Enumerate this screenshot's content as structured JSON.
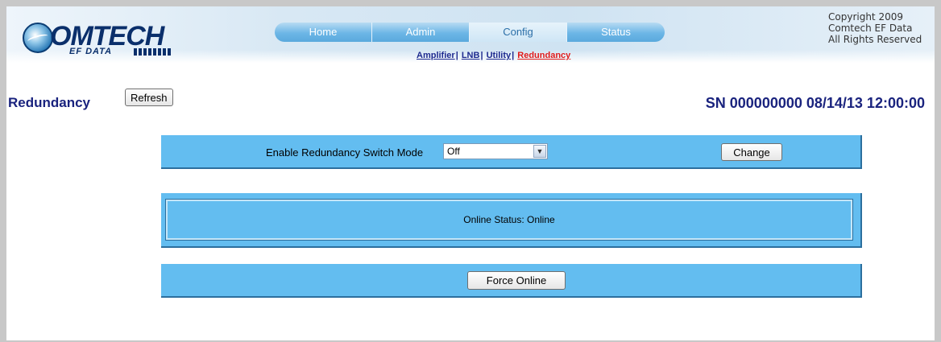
{
  "header": {
    "logo": {
      "word": "OMTECH",
      "sub": "EF DATA"
    },
    "copyright": [
      "Copyright 2009",
      "Comtech EF Data",
      "All Rights Reserved"
    ],
    "tabs": [
      {
        "label": "Home",
        "active": false
      },
      {
        "label": "Admin",
        "active": false
      },
      {
        "label": "Config",
        "active": true
      },
      {
        "label": "Status",
        "active": false
      }
    ],
    "subnav": [
      {
        "label": "Amplifier",
        "active": false
      },
      {
        "label": "LNB",
        "active": false
      },
      {
        "label": "Utility",
        "active": false
      },
      {
        "label": "Redundancy",
        "active": true
      }
    ],
    "subnav_separator": "|"
  },
  "page": {
    "title": "Redundancy",
    "refresh_label": "Refresh",
    "serial_line": "SN 000000000 08/14/13 12:00:00"
  },
  "switch_mode": {
    "label": "Enable Redundancy Switch Mode",
    "selected": "Off",
    "change_label": "Change"
  },
  "status": {
    "text": "Online Status: Online"
  },
  "force": {
    "label": "Force Online"
  },
  "colors": {
    "panel": "#63bdf0",
    "title": "#1a237e",
    "active_subnav": "#e01b1b"
  }
}
